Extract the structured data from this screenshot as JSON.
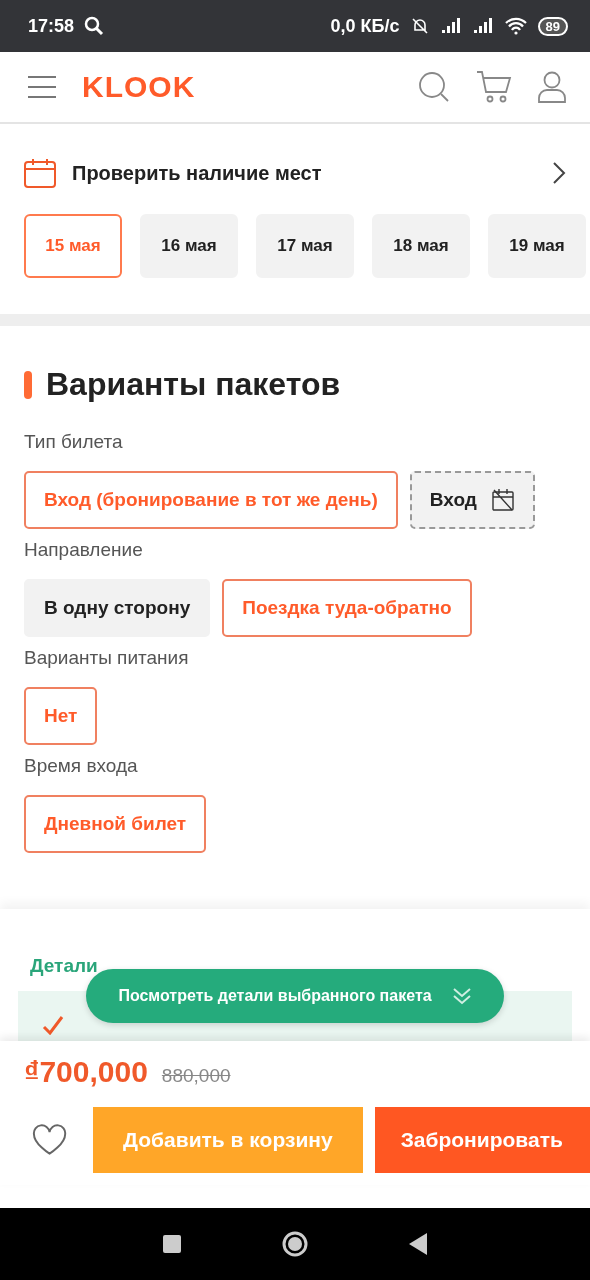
{
  "status_bar": {
    "time": "17:58",
    "speed": "0,0 КБ/с",
    "battery": "89"
  },
  "header": {
    "logo": "KLOOK"
  },
  "availability": {
    "title": "Проверить наличие мест",
    "dates": [
      {
        "label": "15 мая",
        "selected": true
      },
      {
        "label": "16 мая",
        "selected": false
      },
      {
        "label": "17 мая",
        "selected": false
      },
      {
        "label": "18 мая",
        "selected": false
      },
      {
        "label": "19 мая",
        "selected": false
      }
    ]
  },
  "packages": {
    "title": "Варианты пакетов",
    "groups": [
      {
        "label": "Тип билета",
        "options": [
          {
            "label": "Вход (бронирование в тот же день)",
            "selected": true,
            "disabled": false
          },
          {
            "label": "Вход",
            "selected": false,
            "disabled": true
          }
        ]
      },
      {
        "label": "Направление",
        "options": [
          {
            "label": "В одну сторону",
            "selected": false,
            "disabled": false
          },
          {
            "label": "Поездка туда-обратно",
            "selected": true,
            "disabled": false
          }
        ]
      },
      {
        "label": "Варианты питания",
        "options": [
          {
            "label": "Нет",
            "selected": true,
            "disabled": false
          }
        ]
      },
      {
        "label": "Время входа",
        "options": [
          {
            "label": "Дневной билет",
            "selected": true,
            "disabled": false
          }
        ]
      }
    ]
  },
  "details": {
    "title": "Детали",
    "toggle": "Посмотреть детали выбранного пакета"
  },
  "footer": {
    "price": "₫700,000",
    "old_price": "880,000",
    "add_to_cart": "Добавить в корзину",
    "book": "Забронировать"
  }
}
